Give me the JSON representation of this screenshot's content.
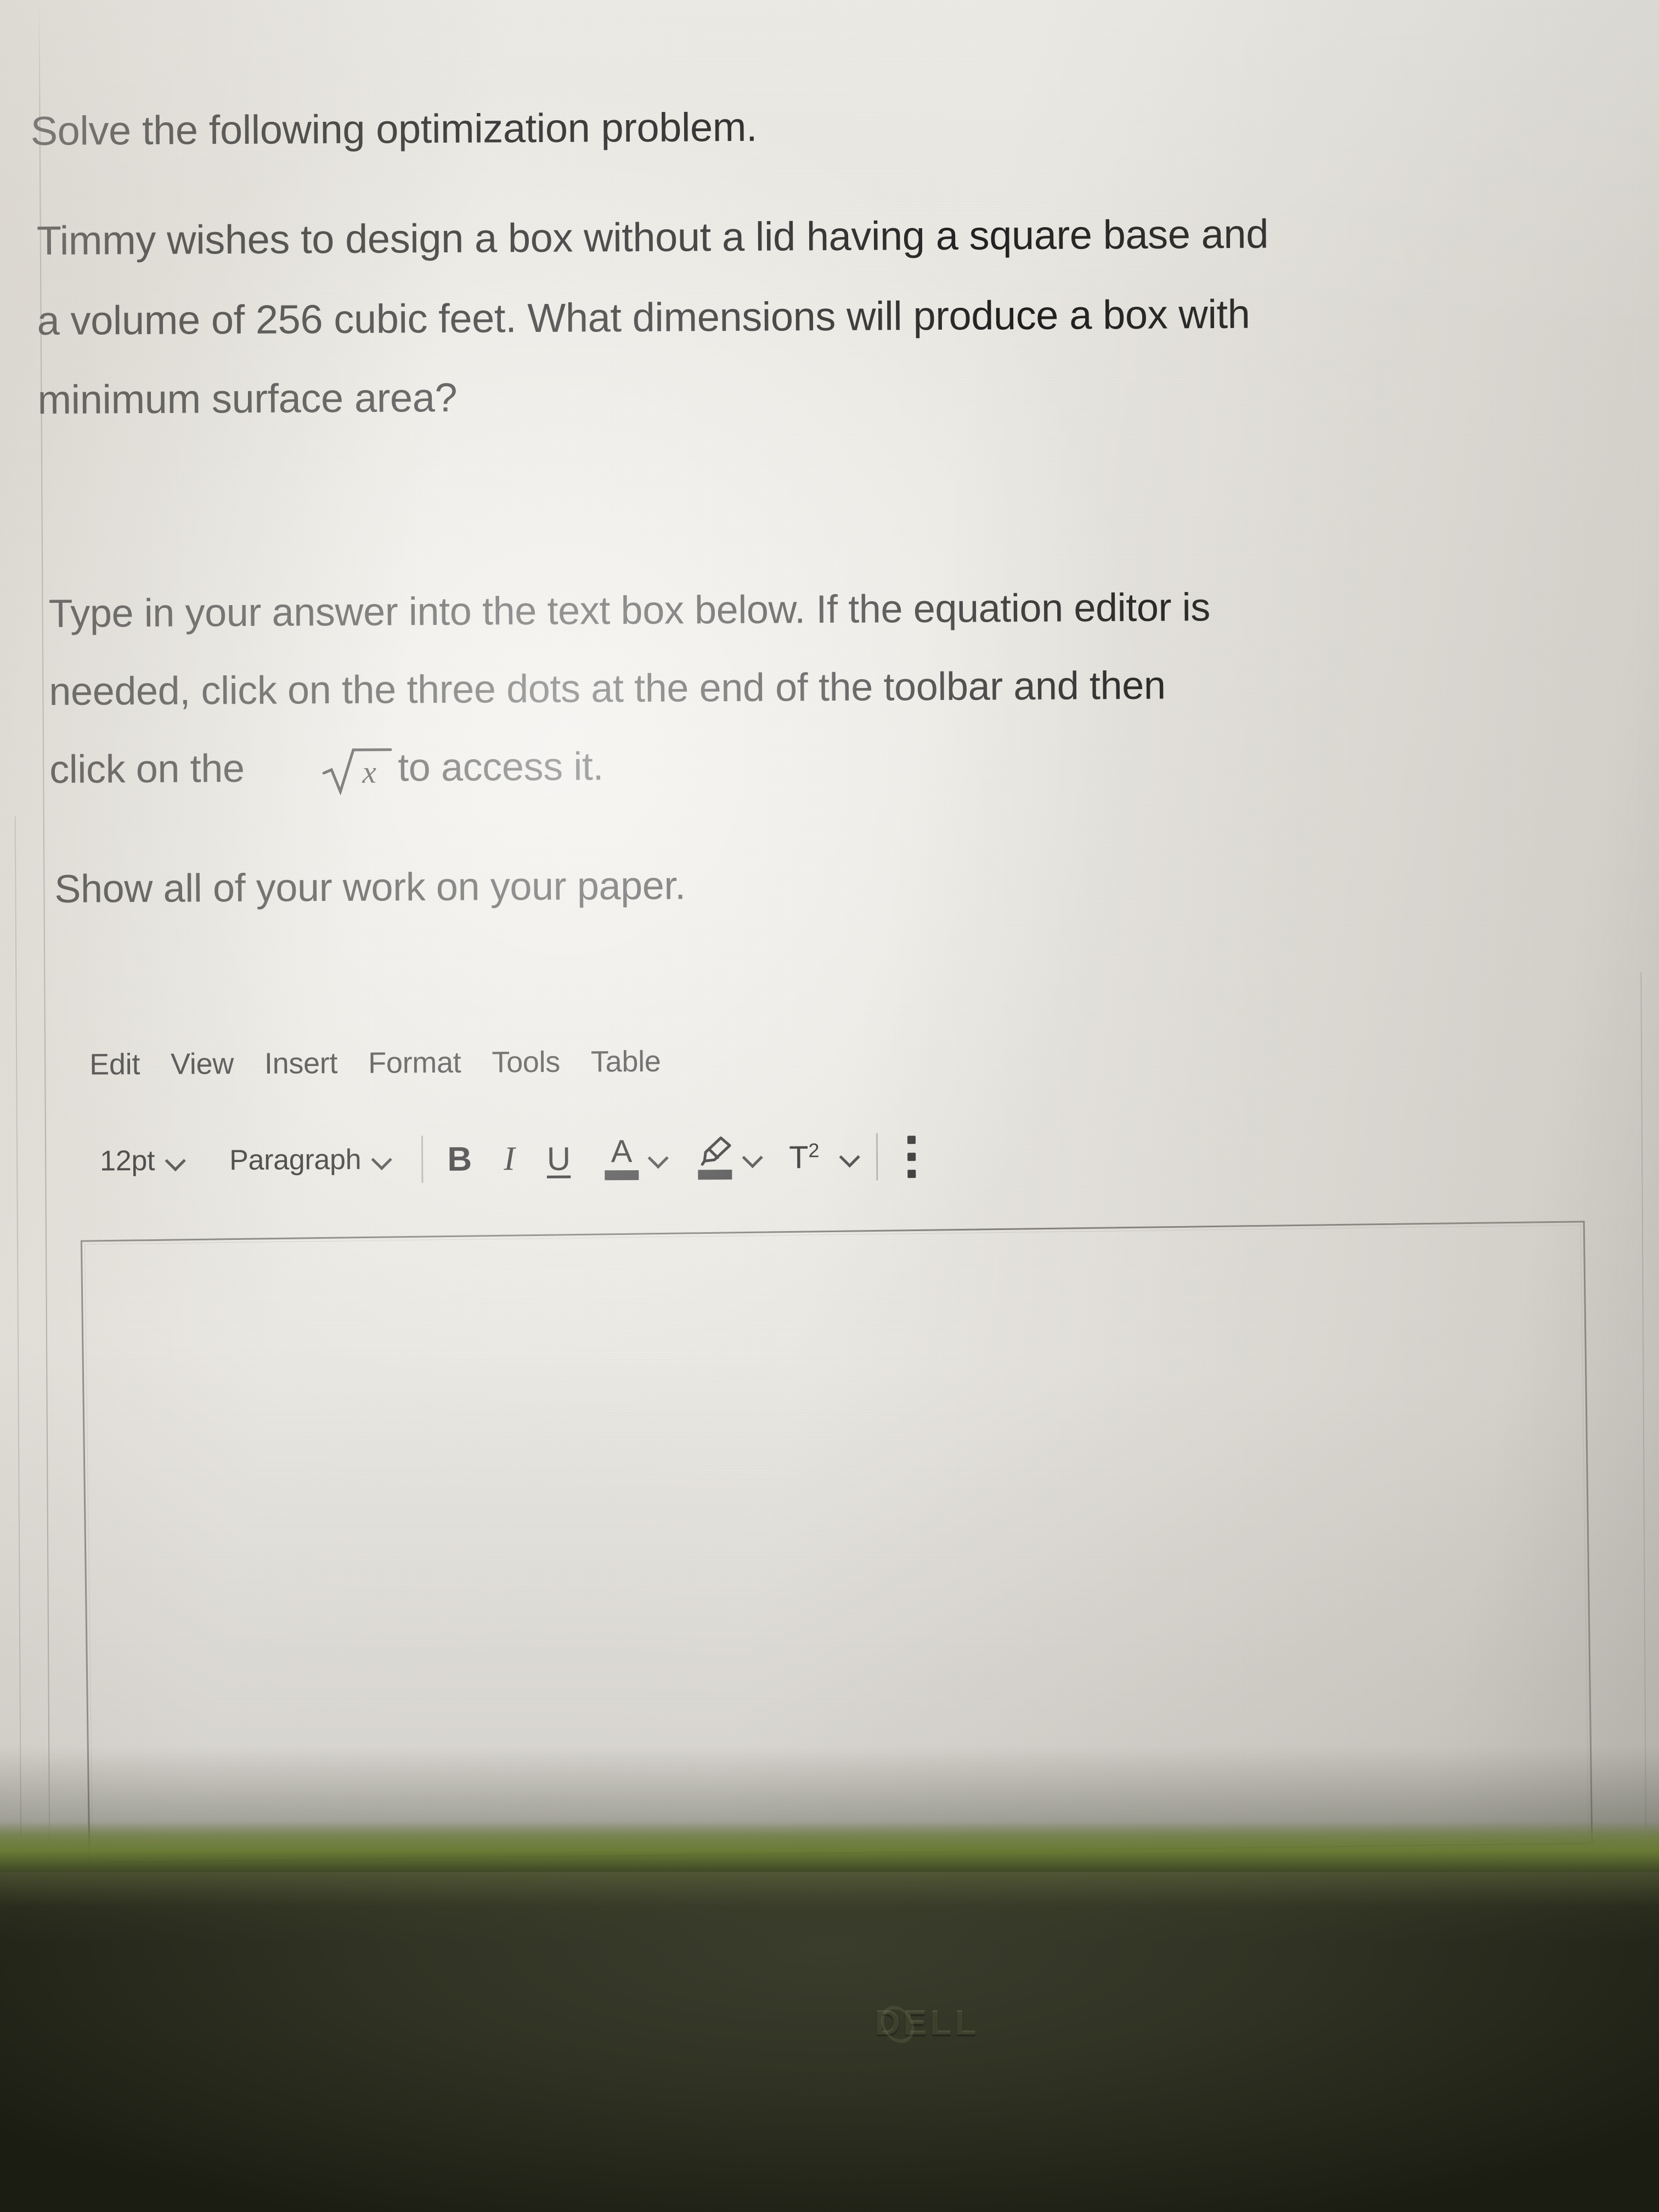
{
  "question": {
    "instruction": "Solve the following optimization problem.",
    "problem_lines": [
      "Timmy wishes to design a box without a lid having a square base and",
      "a volume of 256 cubic feet. What dimensions will produce a box with",
      "minimum surface area?"
    ],
    "directions_lines": [
      "Type in your answer into the text box below. If the equation editor is",
      "needed, click on the three dots at the end of the toolbar and then"
    ],
    "directions_last_before_math": "click on the",
    "directions_last_after_math": "to access it.",
    "math_inline": "√x",
    "footer_note": "Show all of your work on your paper."
  },
  "editor": {
    "menubar": [
      {
        "label": "Edit",
        "name": "menu-edit"
      },
      {
        "label": "View",
        "name": "menu-view"
      },
      {
        "label": "Insert",
        "name": "menu-insert"
      },
      {
        "label": "Format",
        "name": "menu-format"
      },
      {
        "label": "Tools",
        "name": "menu-tools"
      },
      {
        "label": "Table",
        "name": "menu-table"
      }
    ],
    "toolbar": {
      "font_size_value": "12pt",
      "block_format_value": "Paragraph",
      "bold_label": "B",
      "italic_label": "I",
      "underline_label": "U",
      "text_color_label": "A",
      "superscript_label": "T",
      "superscript_exponent": "2",
      "text_color_swatch": "#3c3c3c",
      "highlight_swatch": "#3c3c3c",
      "more_options_label": "⋮"
    },
    "answer_textbox": {
      "value": "",
      "placeholder": ""
    }
  },
  "device": {
    "brand_logo": "DELL"
  },
  "colors": {
    "screen_background": "#eceae4",
    "body_text": "#1c1c1c",
    "toolbar_text": "#242424",
    "textbox_border": "#56544e",
    "bezel": "#2a2c1e",
    "backlight_bleed": "#687c30"
  }
}
